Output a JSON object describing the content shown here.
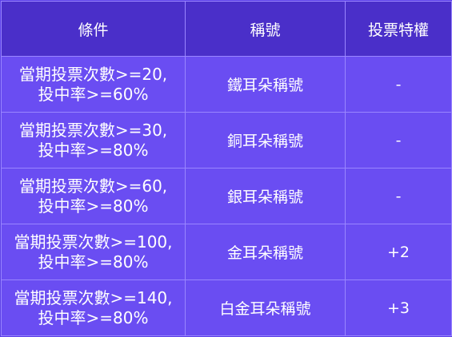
{
  "table": {
    "headers": [
      "條件",
      "稱號",
      "投票特權"
    ],
    "rows": [
      {
        "condition_line1": "當期投票次數>=20,",
        "condition_line2": "投中率>=60%",
        "title": "鐵耳朵稱號",
        "privilege": "-"
      },
      {
        "condition_line1": "當期投票次數>=30,",
        "condition_line2": "投中率>=80%",
        "title": "銅耳朵稱號",
        "privilege": "-"
      },
      {
        "condition_line1": "當期投票次數>=60,",
        "condition_line2": "投中率>=80%",
        "title": "銀耳朵稱號",
        "privilege": "-"
      },
      {
        "condition_line1": "當期投票次數>=100,",
        "condition_line2": "投中率>=80%",
        "title": "金耳朵稱號",
        "privilege": "+2"
      },
      {
        "condition_line1": "當期投票次數>=140,",
        "condition_line2": "投中率>=80%",
        "title": "白金耳朵稱號",
        "privilege": "+3"
      }
    ]
  },
  "colors": {
    "header_bg": "#4a2fc9",
    "cell_bg": "#6a4df2",
    "border": "#9a86ff",
    "text": "#ffffff"
  }
}
